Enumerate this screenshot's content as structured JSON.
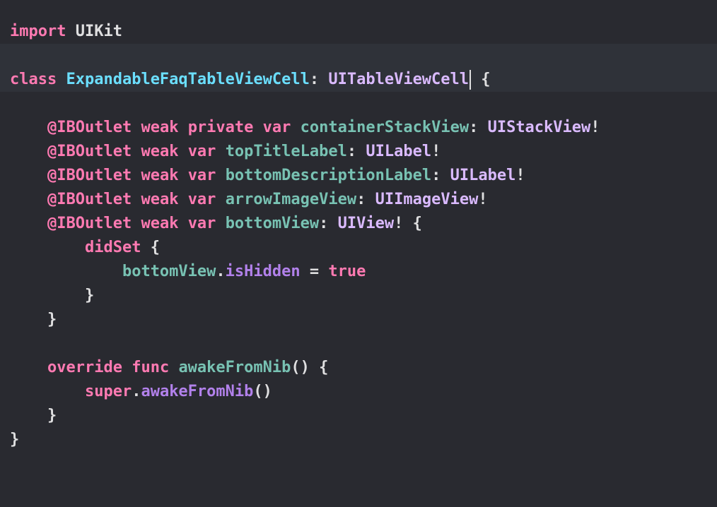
{
  "editor": {
    "lines": [
      {
        "tokens": [
          {
            "t": "import",
            "k": "kw"
          },
          {
            "t": " ",
            "k": "plain"
          },
          {
            "t": "UIKit",
            "k": "plain"
          }
        ]
      },
      {
        "tokens": [],
        "highlight": true
      },
      {
        "tokens": [
          {
            "t": "class",
            "k": "kw"
          },
          {
            "t": " ",
            "k": "plain"
          },
          {
            "t": "ExpandableFaqTableViewCell",
            "k": "type-decl"
          },
          {
            "t": ": ",
            "k": "plain"
          },
          {
            "t": "UITableViewCell",
            "k": "type"
          },
          {
            "caret": true
          },
          {
            "t": " {",
            "k": "plain"
          }
        ],
        "highlight": true
      },
      {
        "tokens": []
      },
      {
        "tokens": [
          {
            "t": "    ",
            "k": "plain"
          },
          {
            "t": "@IBOutlet",
            "k": "kw"
          },
          {
            "t": " ",
            "k": "plain"
          },
          {
            "t": "weak",
            "k": "kw"
          },
          {
            "t": " ",
            "k": "plain"
          },
          {
            "t": "private",
            "k": "kw"
          },
          {
            "t": " ",
            "k": "plain"
          },
          {
            "t": "var",
            "k": "kw"
          },
          {
            "t": " ",
            "k": "plain"
          },
          {
            "t": "containerStackView",
            "k": "ident"
          },
          {
            "t": ": ",
            "k": "plain"
          },
          {
            "t": "UIStackView",
            "k": "type"
          },
          {
            "t": "!",
            "k": "plain"
          }
        ]
      },
      {
        "tokens": [
          {
            "t": "    ",
            "k": "plain"
          },
          {
            "t": "@IBOutlet",
            "k": "kw"
          },
          {
            "t": " ",
            "k": "plain"
          },
          {
            "t": "weak",
            "k": "kw"
          },
          {
            "t": " ",
            "k": "plain"
          },
          {
            "t": "var",
            "k": "kw"
          },
          {
            "t": " ",
            "k": "plain"
          },
          {
            "t": "topTitleLabel",
            "k": "ident"
          },
          {
            "t": ": ",
            "k": "plain"
          },
          {
            "t": "UILabel",
            "k": "type"
          },
          {
            "t": "!",
            "k": "plain"
          }
        ]
      },
      {
        "tokens": [
          {
            "t": "    ",
            "k": "plain"
          },
          {
            "t": "@IBOutlet",
            "k": "kw"
          },
          {
            "t": " ",
            "k": "plain"
          },
          {
            "t": "weak",
            "k": "kw"
          },
          {
            "t": " ",
            "k": "plain"
          },
          {
            "t": "var",
            "k": "kw"
          },
          {
            "t": " ",
            "k": "plain"
          },
          {
            "t": "bottomDescriptionLabel",
            "k": "ident"
          },
          {
            "t": ": ",
            "k": "plain"
          },
          {
            "t": "UILabel",
            "k": "type"
          },
          {
            "t": "!",
            "k": "plain"
          }
        ]
      },
      {
        "tokens": [
          {
            "t": "    ",
            "k": "plain"
          },
          {
            "t": "@IBOutlet",
            "k": "kw"
          },
          {
            "t": " ",
            "k": "plain"
          },
          {
            "t": "weak",
            "k": "kw"
          },
          {
            "t": " ",
            "k": "plain"
          },
          {
            "t": "var",
            "k": "kw"
          },
          {
            "t": " ",
            "k": "plain"
          },
          {
            "t": "arrowImageView",
            "k": "ident"
          },
          {
            "t": ": ",
            "k": "plain"
          },
          {
            "t": "UIImageView",
            "k": "type"
          },
          {
            "t": "!",
            "k": "plain"
          }
        ]
      },
      {
        "tokens": [
          {
            "t": "    ",
            "k": "plain"
          },
          {
            "t": "@IBOutlet",
            "k": "kw"
          },
          {
            "t": " ",
            "k": "plain"
          },
          {
            "t": "weak",
            "k": "kw"
          },
          {
            "t": " ",
            "k": "plain"
          },
          {
            "t": "var",
            "k": "kw"
          },
          {
            "t": " ",
            "k": "plain"
          },
          {
            "t": "bottomView",
            "k": "ident"
          },
          {
            "t": ": ",
            "k": "plain"
          },
          {
            "t": "UIView",
            "k": "type"
          },
          {
            "t": "! {",
            "k": "plain"
          }
        ]
      },
      {
        "tokens": [
          {
            "t": "        ",
            "k": "plain"
          },
          {
            "t": "didSet",
            "k": "kw"
          },
          {
            "t": " {",
            "k": "plain"
          }
        ]
      },
      {
        "tokens": [
          {
            "t": "            ",
            "k": "plain"
          },
          {
            "t": "bottomView",
            "k": "ident"
          },
          {
            "t": ".",
            "k": "plain"
          },
          {
            "t": "isHidden",
            "k": "member"
          },
          {
            "t": " = ",
            "k": "plain"
          },
          {
            "t": "true",
            "k": "kw"
          }
        ]
      },
      {
        "tokens": [
          {
            "t": "        ",
            "k": "plain"
          },
          {
            "t": "}",
            "k": "plain"
          }
        ]
      },
      {
        "tokens": [
          {
            "t": "    ",
            "k": "plain"
          },
          {
            "t": "}",
            "k": "plain"
          }
        ]
      },
      {
        "tokens": []
      },
      {
        "tokens": [
          {
            "t": "    ",
            "k": "plain"
          },
          {
            "t": "override",
            "k": "kw"
          },
          {
            "t": " ",
            "k": "plain"
          },
          {
            "t": "func",
            "k": "kw"
          },
          {
            "t": " ",
            "k": "plain"
          },
          {
            "t": "awakeFromNib",
            "k": "ident"
          },
          {
            "t": "() {",
            "k": "plain"
          }
        ]
      },
      {
        "tokens": [
          {
            "t": "        ",
            "k": "plain"
          },
          {
            "t": "super",
            "k": "kw"
          },
          {
            "t": ".",
            "k": "plain"
          },
          {
            "t": "awakeFromNib",
            "k": "member"
          },
          {
            "t": "()",
            "k": "plain"
          }
        ]
      },
      {
        "tokens": [
          {
            "t": "    ",
            "k": "plain"
          },
          {
            "t": "}",
            "k": "plain"
          }
        ]
      },
      {
        "tokens": [
          {
            "t": "}",
            "k": "plain"
          }
        ]
      }
    ]
  },
  "colors": {
    "background": "#292a30",
    "current_line": "#2f3239",
    "keyword": "#ff7ab2",
    "type_declaration": "#6bdfff",
    "type_reference": "#dabaff",
    "identifier": "#78c2b3",
    "member": "#b281eb",
    "plain_text": "#dfdfe0"
  }
}
